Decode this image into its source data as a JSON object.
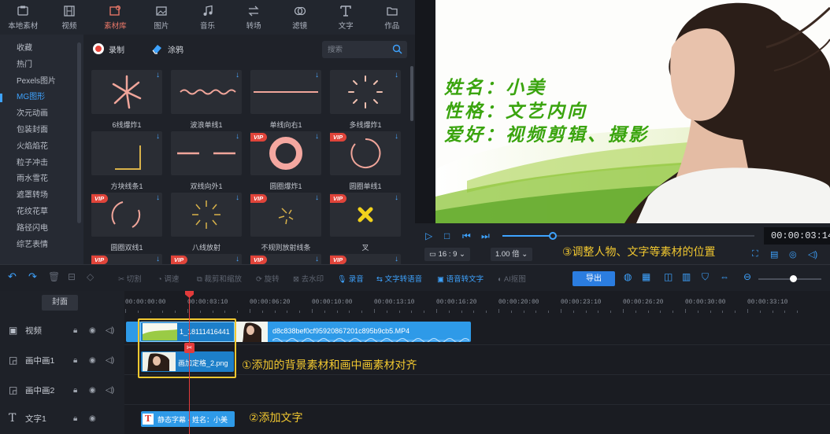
{
  "nav": {
    "items": [
      {
        "label": "本地素材",
        "icon": "local-media-icon"
      },
      {
        "label": "视频",
        "icon": "film-icon"
      },
      {
        "label": "素材库",
        "icon": "media-library-icon",
        "active": true
      },
      {
        "label": "图片",
        "icon": "image-icon"
      },
      {
        "label": "音乐",
        "icon": "music-icon"
      },
      {
        "label": "转场",
        "icon": "transition-icon"
      },
      {
        "label": "滤镜",
        "icon": "filter-icon"
      },
      {
        "label": "文字",
        "icon": "text-icon"
      },
      {
        "label": "作品",
        "icon": "folder-icon"
      }
    ]
  },
  "sidebar": {
    "items": [
      "收藏",
      "热门",
      "Pexels图片",
      "MG图形",
      "次元动画",
      "包装封面",
      "火焰焰花",
      "粒子冲击",
      "雨水雪花",
      "遮罩转场",
      "花纹花草",
      "路径闪电",
      "综艺表情"
    ],
    "active_index": 3
  },
  "library": {
    "record_label": "录制",
    "doodle_label": "涂鸦",
    "search_placeholder": "搜索",
    "vip_text": "VIP",
    "download_glyph": "↓",
    "items": [
      {
        "label": "6线爆炸1",
        "vip": false
      },
      {
        "label": "波浪单线1",
        "vip": false
      },
      {
        "label": "单线向右1",
        "vip": false
      },
      {
        "label": "多线爆炸1",
        "vip": false
      },
      {
        "label": "方块线条1",
        "vip": false
      },
      {
        "label": "双线向外1",
        "vip": false
      },
      {
        "label": "圆圈爆炸1",
        "vip": true
      },
      {
        "label": "圆圈单线1",
        "vip": true
      },
      {
        "label": "圆圈双线1",
        "vip": true
      },
      {
        "label": "八线放射",
        "vip": false
      },
      {
        "label": "不规则放射线条",
        "vip": true
      },
      {
        "label": "叉",
        "vip": true
      },
      {
        "label": "",
        "vip": true
      },
      {
        "label": "",
        "vip": true
      },
      {
        "label": "",
        "vip": true
      },
      {
        "label": "",
        "vip": true
      }
    ]
  },
  "preview": {
    "lines": [
      "姓名：小美",
      "性格：文艺内向",
      "爱好：视频剪辑、摄影"
    ],
    "text_color": "#3aa40e"
  },
  "player": {
    "timecode": "00:00:03:14",
    "progress": 0.2,
    "aspect_label": "16 : 9",
    "speed_label": "1.00 倍",
    "chevron": "⌄"
  },
  "toolbar": {
    "items": [
      "切割",
      "调速",
      "裁剪和缩放",
      "旋转",
      "去水印",
      "录音",
      "文字转语音",
      "语音转文字",
      "AI抠图"
    ],
    "export_label": "导出"
  },
  "timeline": {
    "cover_label": "封面",
    "ticks": [
      "00:00:00:00",
      "00:00:03:10",
      "00:00:06:20",
      "00:00:10:00",
      "00:00:13:10",
      "00:00:16:20",
      "00:00:20:00",
      "00:00:23:10",
      "00:00:26:20",
      "00:00:30:00",
      "00:00:33:10"
    ],
    "tracks": [
      {
        "name": "视频",
        "icon": "film-icon"
      },
      {
        "name": "画中画1",
        "icon": "pip-icon"
      },
      {
        "name": "画中画2",
        "icon": "pip-icon"
      },
      {
        "name": "文字1",
        "icon": "text-icon"
      }
    ],
    "clips": {
      "video_main": "d8c838bef0cf95920867201c895b9cb5.MP4",
      "video_bg": "1_18111416441",
      "pip": "画加定格_2.png",
      "text_icon": "T",
      "text": "静态字幕 - 姓名：小美"
    }
  },
  "annotations": {
    "note1": "①添加的背景素材和画中画素材对齐",
    "note2": "②添加文字",
    "note3": "③调整人物、文字等素材的位置"
  },
  "colors": {
    "accent": "#3ea3ff",
    "annotation": "#f2c830",
    "active_nav": "#f07a6a",
    "vip": "#e0443a"
  }
}
